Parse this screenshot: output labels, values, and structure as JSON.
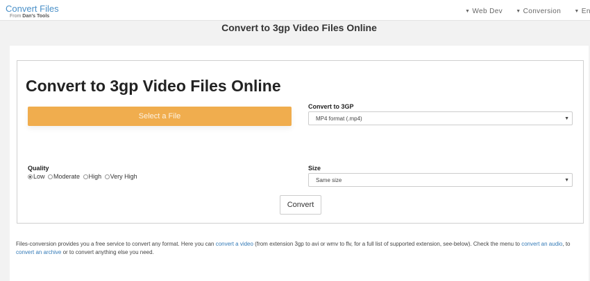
{
  "header": {
    "brand_title": "Convert Files",
    "brand_prefix": "From",
    "brand_owner": "Dan's Tools",
    "nav": [
      {
        "label": "Web Dev"
      },
      {
        "label": "Conversion"
      },
      {
        "label": "Enco"
      }
    ]
  },
  "page": {
    "heading": "Convert to 3gp Video Files Online"
  },
  "form": {
    "title": "Convert to 3gp Video Files Online",
    "select_file_label": "Select a File",
    "convert_to_label": "Convert to 3GP",
    "convert_to_value": "MP4 format (.mp4)",
    "quality_label": "Quality",
    "quality_options": [
      {
        "label": "Low",
        "selected": true
      },
      {
        "label": "Moderate",
        "selected": false
      },
      {
        "label": "High",
        "selected": false
      },
      {
        "label": "Very High",
        "selected": false
      }
    ],
    "size_label": "Size",
    "size_value": "Same size",
    "convert_button": "Convert"
  },
  "description": {
    "part1": "Files-conversion provides you a free service to convert any format. Here you can ",
    "link1": "convert a video",
    "part2": " (from extension 3gp to avi or wmv to flv, for a full list of supported extension, see-below). Check the menu to ",
    "link2": "convert an audio",
    "part3": ", to ",
    "link3": "convert an archive",
    "part4": " or to convert anything else you need."
  },
  "colors": {
    "brand": "#4a90c8",
    "primary_button": "#f0ad4e",
    "link": "#337ab7"
  }
}
